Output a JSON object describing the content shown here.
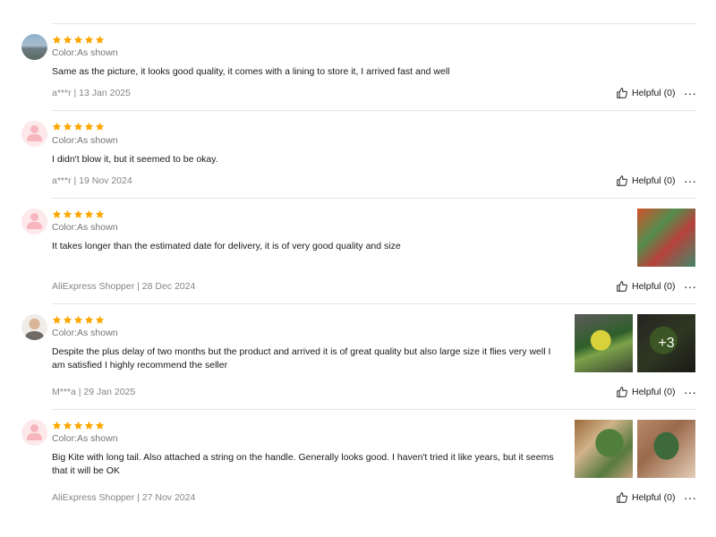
{
  "colors": {
    "star": "#fda700",
    "divider": "#e6e6e6",
    "text": "#191919",
    "meta": "#858585"
  },
  "icons": {
    "star": "star-icon",
    "helpful": "thumbs-up-icon",
    "more": "more-options-icon"
  },
  "reviews": [
    {
      "rating": 5,
      "sku": "Color:As shown",
      "text": "Same as the picture, it looks good quality, it comes with a lining to store it, I arrived fast and well",
      "meta": "a***r | 13 Jan 2025",
      "helpful": "Helpful (0)",
      "more": "···"
    },
    {
      "rating": 5,
      "sku": "Color:As shown",
      "text": "I didn't blow it, but it seemed to be okay.",
      "meta": "a***r | 19 Nov 2024",
      "helpful": "Helpful (0)",
      "more": "···"
    },
    {
      "rating": 5,
      "sku": "Color:As shown",
      "text": "It takes longer than the estimated date for delivery, it is of very good quality and size",
      "meta": "AliExpress Shopper | 28 Dec 2024",
      "helpful": "Helpful (0)",
      "more": "···"
    },
    {
      "rating": 5,
      "sku": "Color:As shown",
      "text": "Despite the plus delay of two months but the product and arrived it is of great quality but also large size it flies very well I am satisfied I highly recommend the seller",
      "meta": "M***a | 29 Jan 2025",
      "helpful": "Helpful (0)",
      "more": "···",
      "more_photos": "+3"
    },
    {
      "rating": 5,
      "sku": "Color:As shown",
      "text": "Big Kite with long tail. Also attached a string on the handle. Generally looks good. I haven't tried it like years, but it seems that it will be OK",
      "meta": "AliExpress Shopper | 27 Nov 2024",
      "helpful": "Helpful (0)",
      "more": "···"
    }
  ]
}
